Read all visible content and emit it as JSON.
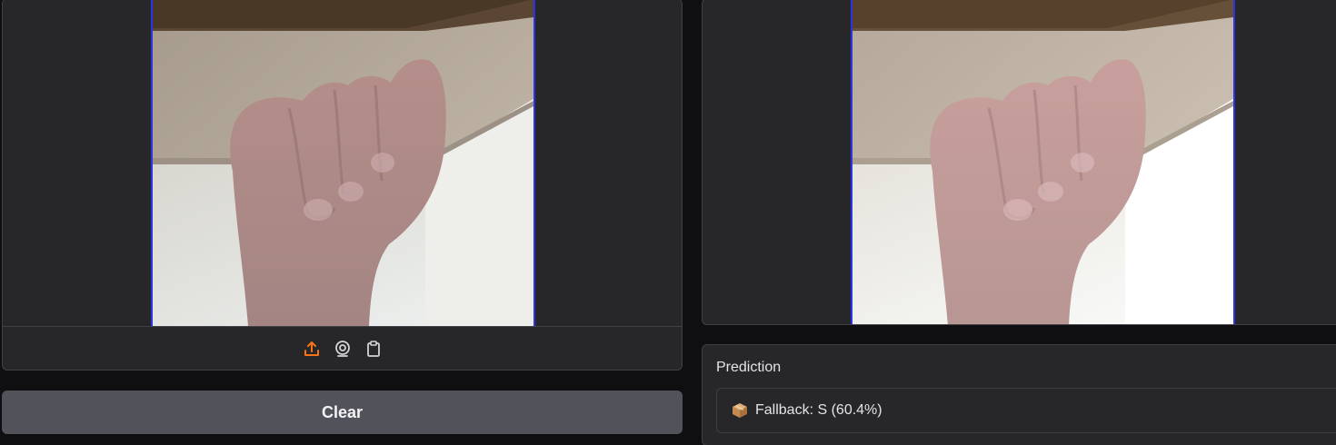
{
  "input": {
    "image_alt": "hand sign input image",
    "sources": [
      {
        "name": "upload",
        "icon": "upload-icon",
        "active": true
      },
      {
        "name": "webcam",
        "icon": "webcam-icon",
        "active": false
      },
      {
        "name": "clipboard",
        "icon": "clipboard-icon",
        "active": false
      }
    ]
  },
  "clear_label": "Clear",
  "output": {
    "image_alt": "processed hand sign image"
  },
  "prediction": {
    "label": "Prediction",
    "icon": "package-icon",
    "text": "Fallback: S (60.4%)"
  },
  "colors": {
    "accent": "#f97316",
    "panel": "#27272a",
    "border": "#3f3f46",
    "button": "#52525b",
    "frame": "#2a33e6"
  }
}
